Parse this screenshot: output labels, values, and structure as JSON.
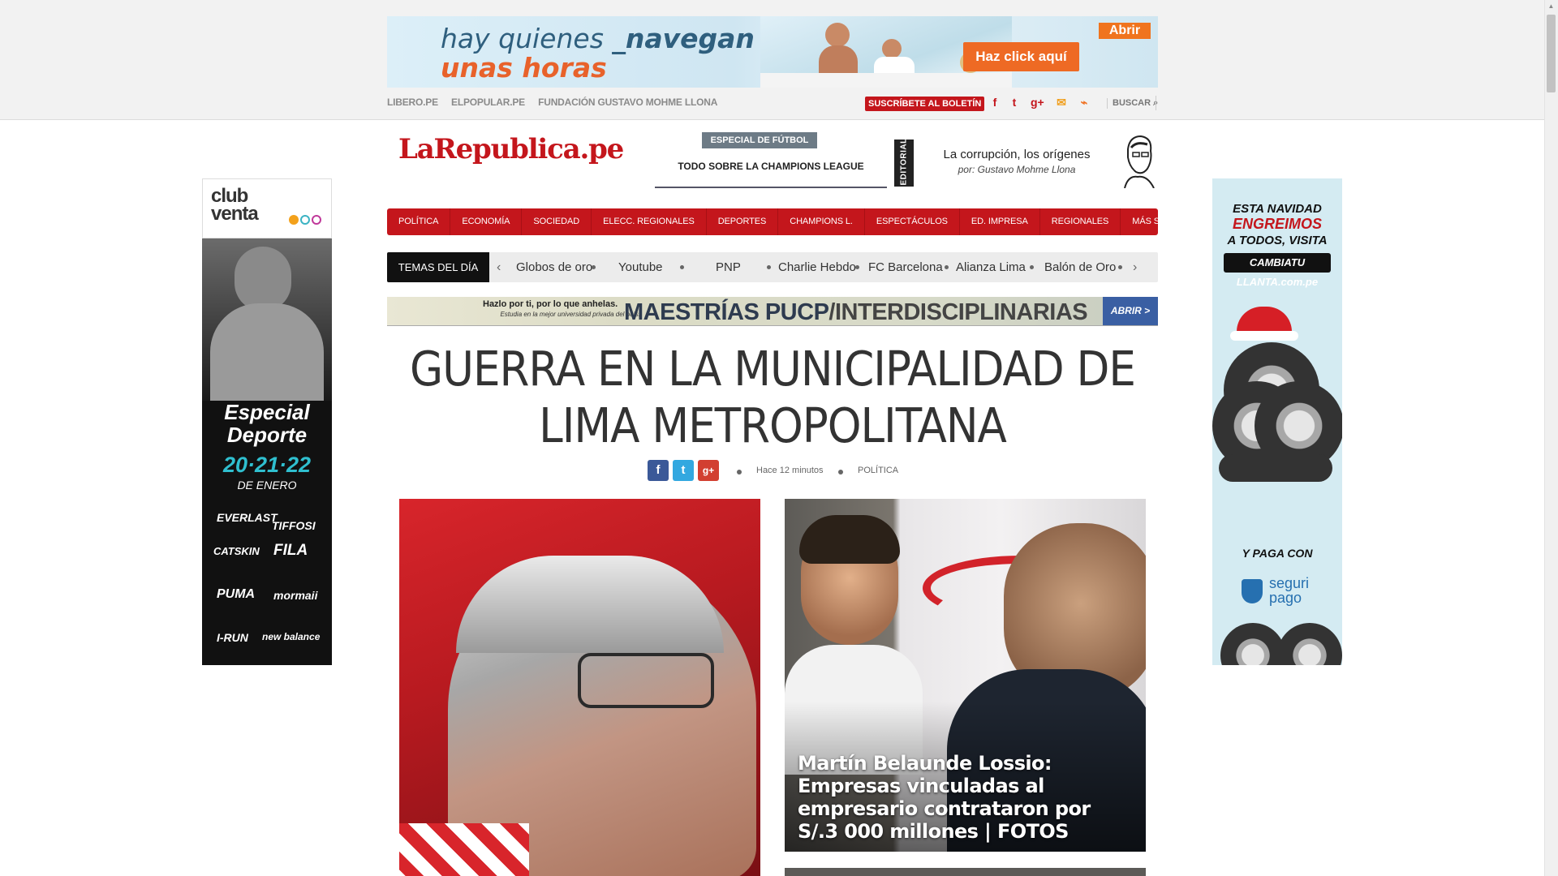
{
  "top_ad": {
    "line1_prefix": "hay quienes ",
    "line1_bold": "_navegan",
    "line2": "unas horas",
    "abrir": "Abrir",
    "cta": "Haz click aquí"
  },
  "top_links": [
    "LIBERO.PE",
    "ELPOPULAR.PE",
    "FUNDACIÓN GUSTAVO MOHME LLONA"
  ],
  "subscribe": "SUSCRÍBETE AL BOLETÍN",
  "social": {
    "facebook": "f",
    "twitter": "t",
    "googleplus": "g+",
    "mail": "✉",
    "rss": "⌁"
  },
  "search_label": "BUSCAR ⌕",
  "logo": "LaRepublica.pe",
  "especial": {
    "tag": "ESPECIAL DE FÚTBOL",
    "text": "TODO SOBRE LA CHAMPIONS LEAGUE"
  },
  "editorial": {
    "tag": "EDITORIAL",
    "title": "La corrupción, los orígenes",
    "author": "por: Gustavo Mohme Llona"
  },
  "nav": [
    "POLÍTICA",
    "ECONOMÍA",
    "SOCIEDAD",
    "ELECC. REGIONALES",
    "DEPORTES",
    "CHAMPIONS L.",
    "ESPECTÁCULOS",
    "ED. IMPRESA",
    "REGIONALES",
    "MÁS SECCIONES ⌄"
  ],
  "temas": {
    "label": "TEMAS DEL DÍA",
    "items": [
      "Globos de oro",
      "Youtube",
      "PNP",
      "Charlie Hebdo",
      "FC Barcelona",
      "Alianza Lima",
      "Balón de Oro"
    ],
    "prev": "‹",
    "next": "›"
  },
  "banner": {
    "small1": "Hazlo por ti, por lo que anhelas.",
    "small2": "Estudia en la mejor universidad privada del país.",
    "big1": "MAESTRÍAS PUCP",
    "big2": "/INTERDISCIPLINARIAS",
    "abrir": "ABRIR >"
  },
  "headline": "GUERRA EN LA MUNICIPALIDAD DE LIMA METROPOLITANA",
  "share": {
    "facebook": "f",
    "twitter": "t",
    "googleplus": "g+"
  },
  "meta": {
    "time": "Hace 12 minutos",
    "section": "POLÍTICA"
  },
  "left_ad": {
    "club1": "club",
    "club2": "venta",
    "title1": "Especial",
    "title2": "Deporte",
    "dates": "20·21·22",
    "month": "DE ENERO",
    "brands": [
      "EVERLAST",
      "TIFFOSI",
      "CATSKIN",
      "FILA",
      "PUMA",
      "mormaii",
      "I-RUN",
      "new balance"
    ]
  },
  "right_ad": {
    "line1": "ESTA NAVIDAD",
    "line2": "ENGREIMOS",
    "line3": "A TODOS, VISITA",
    "logo": "CAMBIATU LLANTA.com.pe",
    "paga": "Y PAGA CON",
    "seg1": "seguri",
    "seg2": "pago"
  },
  "story2": {
    "caption": "Martín Belaunde Lossio: Empresas vinculadas al empresario contrataron por S/.3 000 millones | FOTOS"
  },
  "colors": {
    "brand_red": "#c4161c",
    "dark": "#111111",
    "nav_text": "#ffffff"
  }
}
